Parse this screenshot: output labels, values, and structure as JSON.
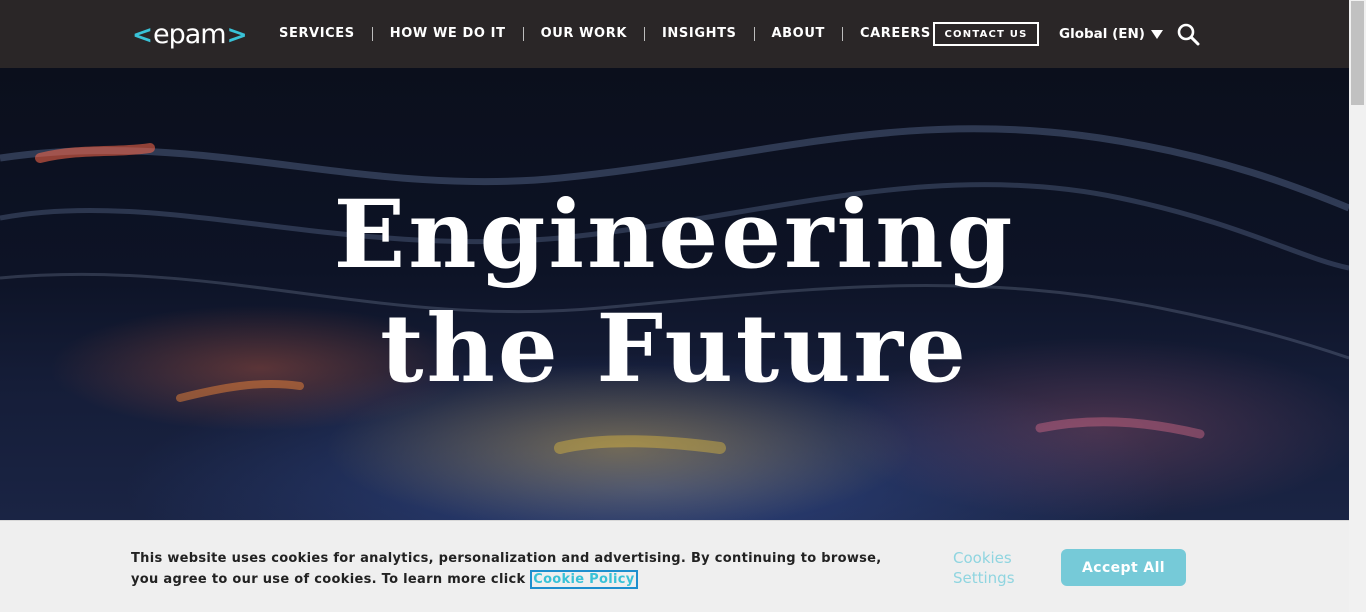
{
  "brand": {
    "logo_left": "<",
    "logo_word": "epam",
    "logo_right": ">",
    "accent_color": "#39c2d7"
  },
  "nav": {
    "items": [
      {
        "label": "SERVICES"
      },
      {
        "label": "HOW WE DO IT"
      },
      {
        "label": "OUR WORK"
      },
      {
        "label": "INSIGHTS"
      },
      {
        "label": "ABOUT"
      },
      {
        "label": "CAREERS"
      }
    ],
    "contact_label": "CONTACT US",
    "language_label": "Global (EN)",
    "search_icon": "search-icon"
  },
  "hero": {
    "title_line1": "Engineering",
    "title_line2": "the Future"
  },
  "cookie_banner": {
    "text": "This website uses cookies for analytics, personalization and advertising. By continuing to browse, you agree to our use of cookies. To learn more click ",
    "link_label": "Cookie Policy",
    "settings_label": "Cookies Settings",
    "accept_label": "Accept All"
  }
}
